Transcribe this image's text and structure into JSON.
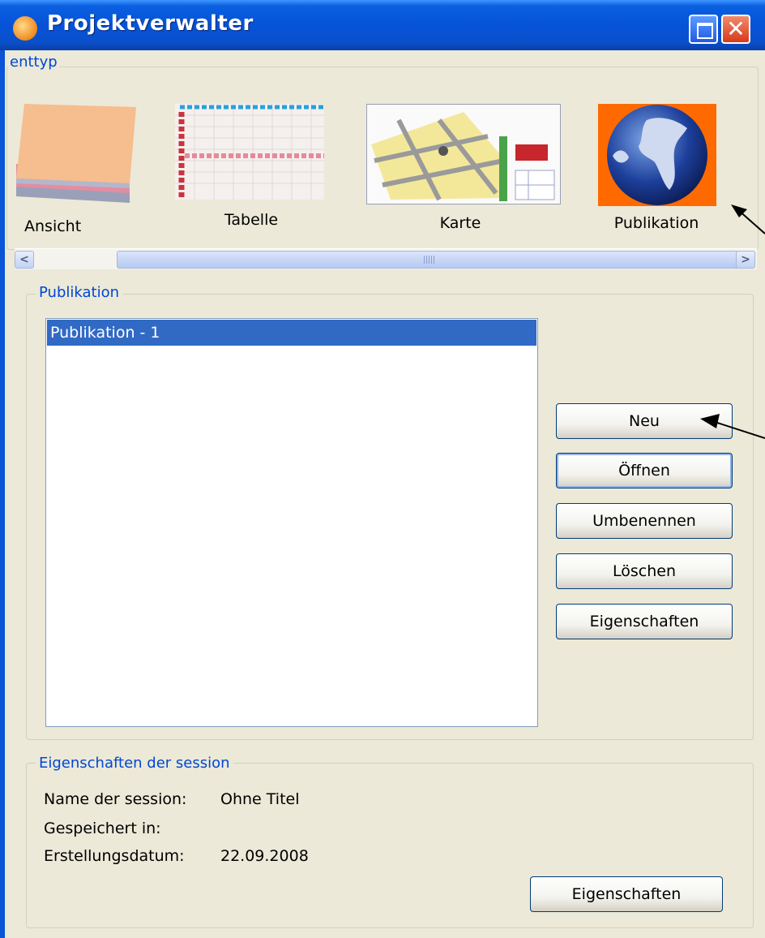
{
  "window": {
    "title": "Projektverwalter",
    "close_glyph": "✕"
  },
  "doctype": {
    "legend": "enttyp",
    "tiles": [
      {
        "label": "Ansicht",
        "icon": "layers-icon"
      },
      {
        "label": "Tabelle",
        "icon": "table-icon"
      },
      {
        "label": "Karte",
        "icon": "map-icon"
      },
      {
        "label": "Publikation",
        "icon": "globe-icon"
      }
    ],
    "scroll_left": "<",
    "scroll_right": ">"
  },
  "publication": {
    "legend": "Publikation",
    "list": [
      "Publikation - 1"
    ],
    "buttons": {
      "new": "Neu",
      "open": "Öffnen",
      "rename": "Umbenennen",
      "delete": "Löschen",
      "properties": "Eigenschaften"
    }
  },
  "session": {
    "legend": "Eigenschaften der session",
    "name_label": "Name der session:",
    "name_value": "Ohne Titel",
    "saved_label": "Gespeichert in:",
    "date_label": "Erstellungsdatum:",
    "date_value": "22.09.2008",
    "properties_button": "Eigenschaften"
  },
  "colors": {
    "titlebar": "#0653d8",
    "selection": "#316ac5",
    "legend_text": "#0046d5",
    "dialog_bg": "#ece9d8"
  }
}
